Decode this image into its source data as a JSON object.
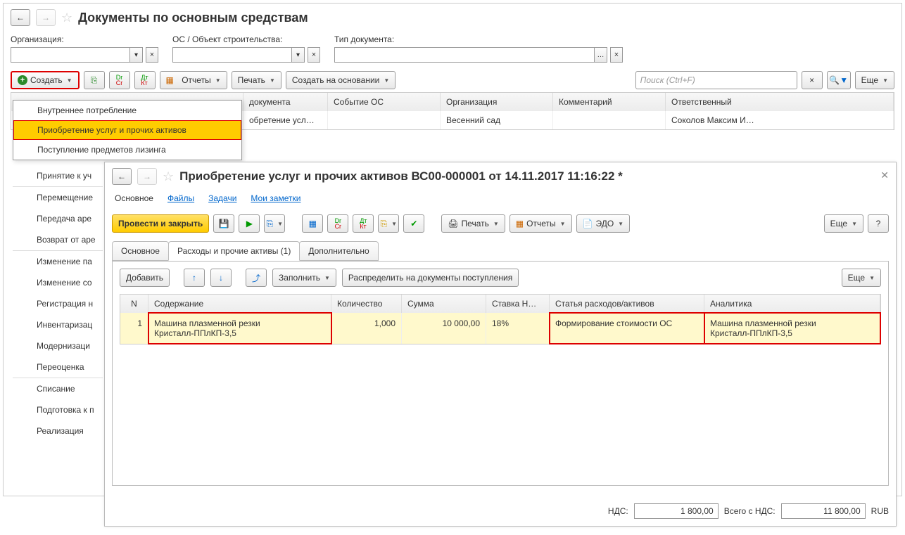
{
  "parent": {
    "title": "Документы по основным средствам",
    "filters": {
      "org_label": "Организация:",
      "os_label": "ОС / Объект строительства:",
      "type_label": "Тип документа:"
    },
    "toolbar": {
      "create": "Создать",
      "reports": "Отчеты",
      "print": "Печать",
      "create_based": "Создать на основании",
      "search_placeholder": "Поиск (Ctrl+F)",
      "more": "Еще"
    },
    "dropdown": [
      "Внутреннее потребление",
      "Приобретение услуг и прочих активов",
      "Поступление предметов лизинга",
      "Принятие к учету ОС",
      "Перемещение ОС",
      "Передача в аренду",
      "Возврат от арендатора",
      "Изменение параметров ОС",
      "Изменение состояния ОС",
      "Регистрация наработок",
      "Инвентаризация ОС",
      "Модернизация ОС",
      "Переоценка",
      "Списание",
      "Подготовка к передаче",
      "Реализация"
    ],
    "side_truncated": [
      "Принятие к уч",
      "Перемещение",
      "Передача аре",
      "Возврат от аре",
      "Изменение па",
      "Изменение со",
      "Регистрация н",
      "Инвентаризац",
      "Модернизаци",
      "Переоценка",
      "Списание",
      "Подготовка к п",
      "Реализация"
    ],
    "table": {
      "th_type": "документа",
      "th_event": "Событие ОС",
      "th_org": "Организация",
      "th_comment": "Комментарий",
      "th_resp": "Ответственный",
      "row_type": "обретение усл…",
      "row_org": "Весенний сад",
      "row_resp": "Соколов Максим И…"
    }
  },
  "inner": {
    "title": "Приобретение услуг и прочих активов ВС00-000001 от 14.11.2017 11:16:22 *",
    "links": {
      "main": "Основное",
      "files": "Файлы",
      "tasks": "Задачи",
      "notes": "Мои заметки"
    },
    "tb": {
      "post_close": "Провести и закрыть",
      "print": "Печать",
      "reports": "Отчеты",
      "edo": "ЭДО",
      "more": "Еще"
    },
    "tabs": {
      "main": "Основное",
      "expenses": "Расходы и прочие активы (1)",
      "extra": "Дополнительно"
    },
    "tab_tb": {
      "add": "Добавить",
      "fill": "Заполнить",
      "dist": "Распределить на документы поступления",
      "more": "Еще"
    },
    "cols": {
      "n": "N",
      "content": "Содержание",
      "qty": "Количество",
      "sum": "Сумма",
      "rate": "Ставка Н…",
      "article": "Статья расходов/активов",
      "analytics": "Аналитика"
    },
    "row": {
      "n": "1",
      "content1": "Машина плазменной резки",
      "content2": "Кристалл-ППлКП-3,5",
      "qty": "1,000",
      "sum": "10 000,00",
      "rate": "18%",
      "article": "Формирование стоимости ОС",
      "analytics1": "Машина плазменной резки",
      "analytics2": "Кристалл-ППлКП-3,5"
    },
    "footer": {
      "nds_label": "НДС:",
      "nds_val": "1 800,00",
      "total_label": "Всего с НДС:",
      "total_val": "11 800,00",
      "cur": "RUB"
    }
  }
}
